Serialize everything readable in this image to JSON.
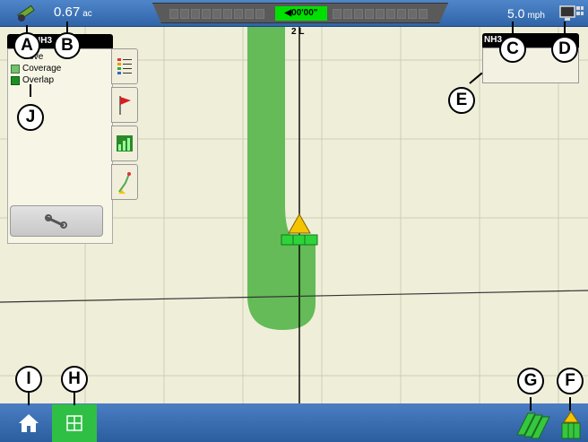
{
  "status_bar": {
    "area_value": "0.67",
    "area_unit": "ac",
    "lightbar_value": "00'00\"",
    "speed_value": "5.0",
    "speed_unit": "mph"
  },
  "map": {
    "row_label": "2 L"
  },
  "left_panel": {
    "header": "NH3",
    "legend": [
      {
        "label": "Cove",
        "color": "#f7f6e6"
      },
      {
        "label": "Coverage",
        "color": "#73c06f"
      },
      {
        "label": "Overlap",
        "color": "#1c8f24"
      }
    ],
    "tabs": [
      "legend-tab-icon",
      "flag-icon",
      "chart-icon",
      "guidance-icon"
    ]
  },
  "right_panel": {
    "header": "NH3"
  },
  "bottom_bar": {
    "home_icon": "home-icon",
    "map_icon": "map-grid-icon",
    "coverage_icon": "coverage-icon",
    "implement_icon": "implement-icon"
  },
  "callouts": [
    "A",
    "B",
    "C",
    "D",
    "E",
    "F",
    "G",
    "H",
    "I",
    "J"
  ],
  "colors": {
    "coverage": "#64bb57",
    "topbar": "#3a6fb5",
    "map_button": "#2fbf45"
  }
}
